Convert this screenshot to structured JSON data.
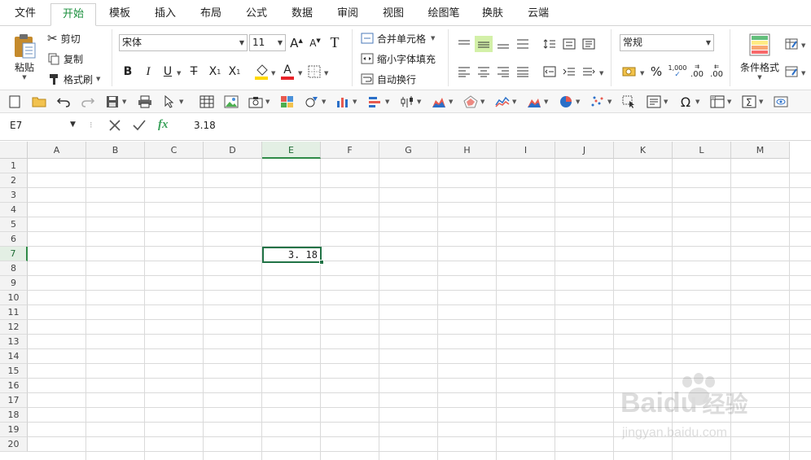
{
  "menu": {
    "tabs": [
      {
        "label": "文件",
        "active": false
      },
      {
        "label": "开始",
        "active": true
      },
      {
        "label": "模板",
        "active": false
      },
      {
        "label": "插入",
        "active": false
      },
      {
        "label": "布局",
        "active": false
      },
      {
        "label": "公式",
        "active": false
      },
      {
        "label": "数据",
        "active": false
      },
      {
        "label": "审阅",
        "active": false
      },
      {
        "label": "视图",
        "active": false
      },
      {
        "label": "绘图笔",
        "active": false
      },
      {
        "label": "换肤",
        "active": false
      },
      {
        "label": "云端",
        "active": false
      }
    ]
  },
  "ribbon": {
    "clipboard": {
      "paste": "粘贴",
      "cut": "剪切",
      "copy": "复制",
      "format_painter": "格式刷"
    },
    "font": {
      "name": "宋体",
      "size": "11",
      "bold": "B",
      "italic": "I",
      "underline": "U",
      "strike": "T",
      "subscript": "X",
      "superscript": "X",
      "font_color_letter": "A"
    },
    "merge": {
      "merge_cells": "合并单元格",
      "shrink_to_fit": "缩小字体填充",
      "wrap_text": "自动换行"
    },
    "number": {
      "format": "常规",
      "percent": "%",
      "thousands": "1,000",
      "inc_decimal": ".00",
      "dec_decimal": ".00"
    },
    "styles": {
      "conditional_format": "条件格式"
    }
  },
  "formula_bar": {
    "cell_ref": "E7",
    "fx": "fx",
    "value": "3.18"
  },
  "grid": {
    "columns": [
      "A",
      "B",
      "C",
      "D",
      "E",
      "F",
      "G",
      "H",
      "I",
      "J",
      "K",
      "L",
      "M"
    ],
    "rows": [
      "1",
      "2",
      "3",
      "4",
      "5",
      "6",
      "7",
      "8",
      "9",
      "10",
      "11",
      "12",
      "13",
      "14",
      "15",
      "16",
      "17",
      "18",
      "19",
      "20"
    ],
    "selected_column": "E",
    "selected_row": "7",
    "active_cell_value": "3. 18"
  },
  "watermark": {
    "brand": "Bai",
    "brand2": "du",
    "brand_cn": "经验",
    "url": "jingyan.baidu.com"
  },
  "colors": {
    "accent": "#217346",
    "tab_active": "#1a8f3c",
    "highlight": "#d3f0a8"
  }
}
